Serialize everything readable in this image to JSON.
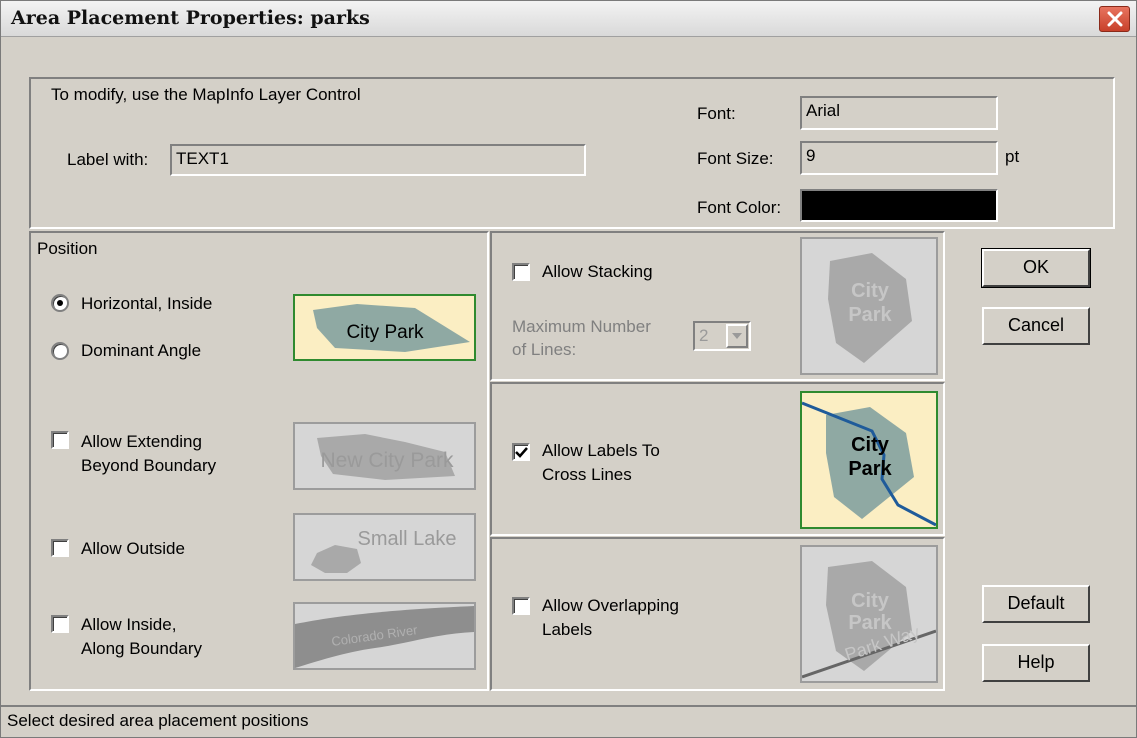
{
  "window": {
    "title": "Area Placement Properties: parks"
  },
  "info": {
    "modify_note": "To modify, use the MapInfo Layer Control",
    "label_with_label": "Label with:",
    "label_with_value": "TEXT1",
    "font_label": "Font:",
    "font_value": "Arial",
    "font_size_label": "Font Size:",
    "font_size_value": "9",
    "font_size_unit": "pt",
    "font_color_label": "Font Color:",
    "font_color_value": "#000000"
  },
  "position": {
    "heading": "Position",
    "horizontal_inside": {
      "label": "Horizontal, Inside",
      "selected": true
    },
    "dominant_angle": {
      "label": "Dominant Angle",
      "selected": false
    },
    "allow_extending": {
      "label_line1": "Allow Extending",
      "label_line2": "Beyond Boundary",
      "checked": false
    },
    "allow_outside": {
      "label": "Allow Outside",
      "checked": false
    },
    "allow_inside_along": {
      "label_line1": "Allow Inside,",
      "label_line2": "Along Boundary",
      "checked": false
    },
    "preview_horizontal": "City Park",
    "preview_extending": "New City Park",
    "preview_outside": "Small Lake",
    "preview_along": "Colorado River"
  },
  "stacking": {
    "allow_stacking": {
      "label": "Allow Stacking",
      "checked": false
    },
    "max_lines_line1": "Maximum Number",
    "max_lines_line2": "of Lines:",
    "max_lines_value": "2",
    "preview_line1": "City",
    "preview_line2": "Park"
  },
  "cross_lines": {
    "label_line1": "Allow Labels To",
    "label_line2": "Cross Lines",
    "checked": true,
    "preview_line1": "City",
    "preview_line2": "Park"
  },
  "overlapping": {
    "label_line1": "Allow Overlapping",
    "label_line2": "Labels",
    "checked": false,
    "preview_line1": "City",
    "preview_line2": "Park",
    "preview_road": "Park Way"
  },
  "buttons": {
    "ok": "OK",
    "cancel": "Cancel",
    "default": "Default",
    "help": "Help"
  },
  "status": {
    "text": "Select desired area placement positions"
  },
  "colors": {
    "polygon": "#8fa9a3",
    "active_bg": "#fbeec3",
    "active_border": "#2f8a2f",
    "road": "#1f5b9a"
  }
}
